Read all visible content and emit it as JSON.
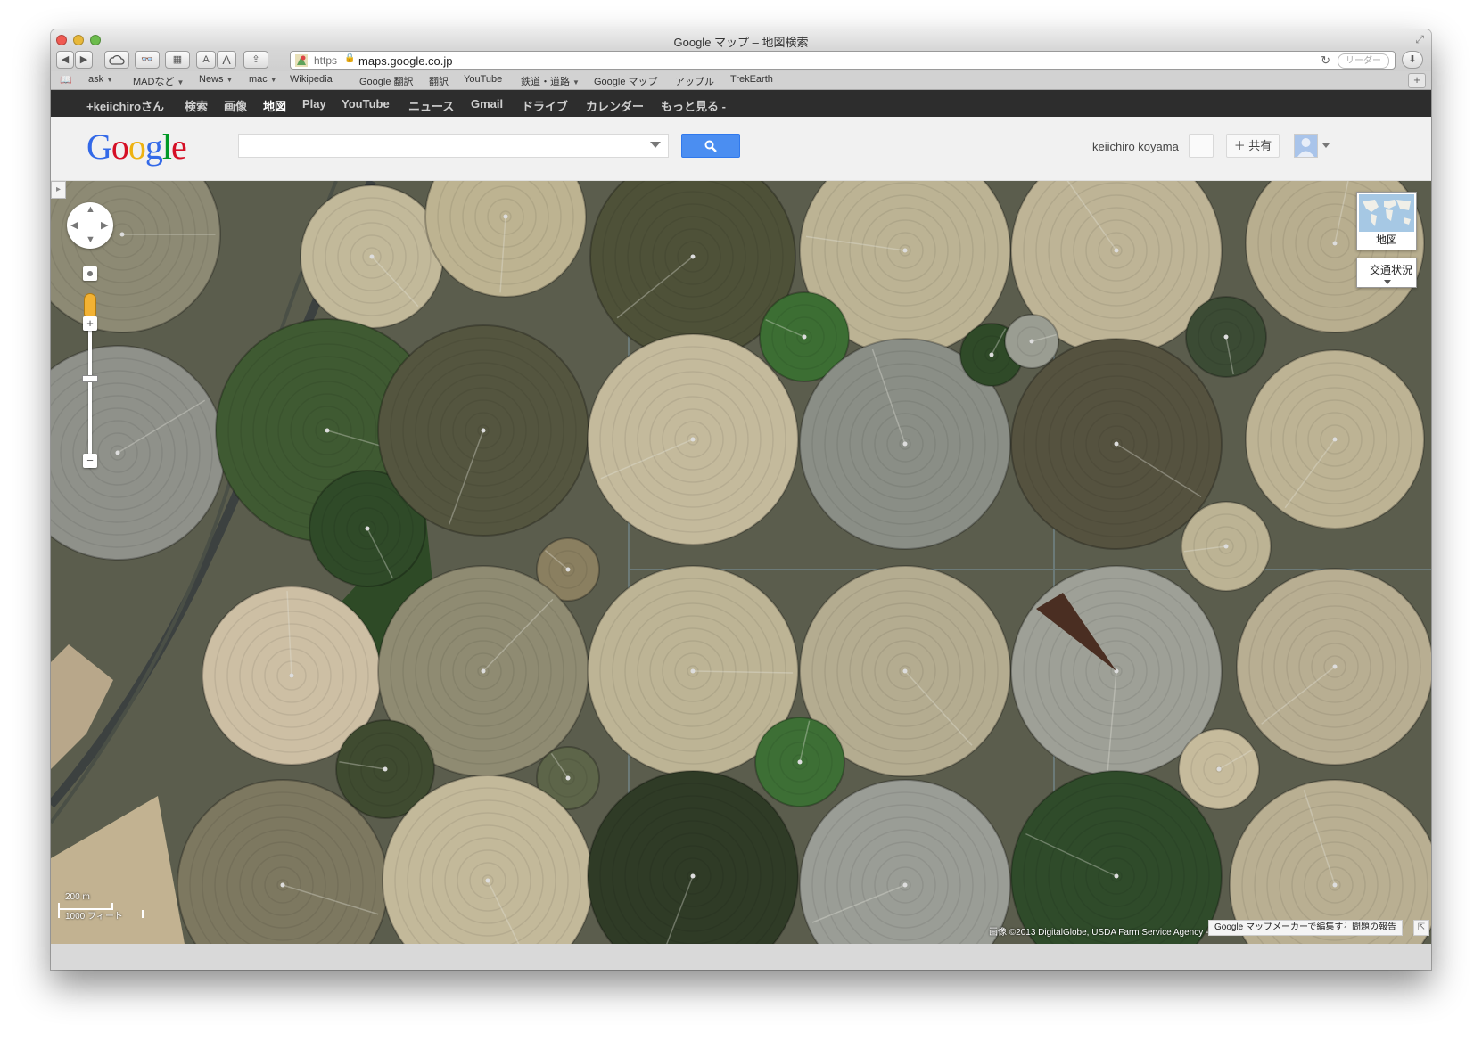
{
  "window": {
    "title": "Google マップ – 地図検索"
  },
  "address": {
    "scheme": "https",
    "host": "maps.google.co.jp",
    "reader_label": "リーダー"
  },
  "bookmarks": [
    "ask",
    "MADなど",
    "News",
    "mac",
    "Wikipedia",
    "Google 翻訳",
    "翻訳",
    "YouTube",
    "鉄道・道路",
    "Google マップ",
    "アップル",
    "TrekEarth"
  ],
  "gbar": {
    "items": [
      "+keiichiroさん",
      "検索",
      "画像",
      "地図",
      "Play",
      "YouTube",
      "ニュース",
      "Gmail",
      "ドライブ",
      "カレンダー",
      "もっと見る -"
    ],
    "active": "地図"
  },
  "header": {
    "logo": "Google",
    "search_value": "",
    "user_name": "keiichiro koyama",
    "share_label": "＋ 共有"
  },
  "map": {
    "type_control_label": "地図",
    "traffic_label": "交通状況",
    "scale_metric": "200 m",
    "scale_imperial": "1000 フィート",
    "copyright": "画像 ©2013 DigitalGlobe, USDA Farm Service Agency -",
    "edit_link": "Google マップメーカーで編集する",
    "report_link": "問題の報告"
  },
  "colors": {
    "gbar_bg": "#2d2d2d",
    "search_button": "#4b8ef1",
    "google_blue": "#3369e8",
    "google_red": "#d50f25",
    "google_yellow": "#eeb211",
    "google_green": "#009925"
  },
  "icons": [
    "back-icon",
    "forward-icon",
    "icloud-icon",
    "reading-list-icon",
    "top-sites-icon",
    "share-icon",
    "reload-icon",
    "download-icon",
    "bookmarks-icon",
    "search-icon",
    "pan-arrows-icon",
    "pegman-icon"
  ]
}
